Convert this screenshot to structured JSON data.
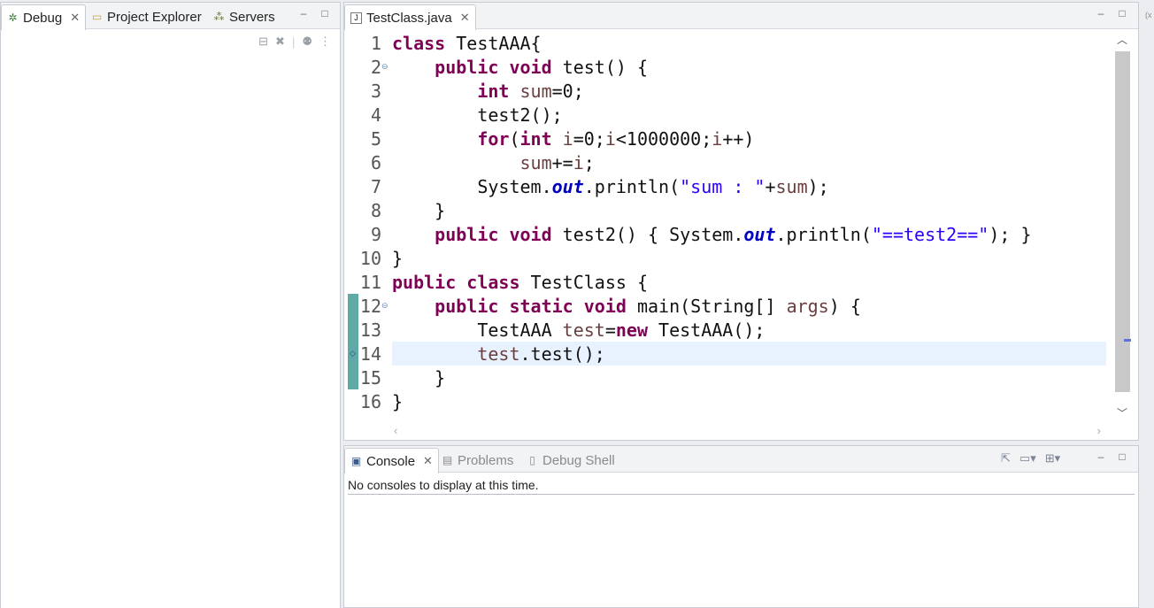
{
  "left_panel": {
    "tabs": [
      {
        "label": "Debug",
        "icon": "bug-icon"
      },
      {
        "label": "Project Explorer",
        "icon": "folder-icon"
      },
      {
        "label": "Servers",
        "icon": "servers-icon"
      }
    ]
  },
  "editor": {
    "tab": {
      "label": "TestClass.java",
      "icon": "java-file-icon"
    },
    "lines": [
      {
        "n": "1"
      },
      {
        "n": "2"
      },
      {
        "n": "3"
      },
      {
        "n": "4"
      },
      {
        "n": "5"
      },
      {
        "n": "6"
      },
      {
        "n": "7"
      },
      {
        "n": "8"
      },
      {
        "n": "9"
      },
      {
        "n": "10"
      },
      {
        "n": "11"
      },
      {
        "n": "12"
      },
      {
        "n": "13"
      },
      {
        "n": "14"
      },
      {
        "n": "15"
      },
      {
        "n": "16"
      }
    ],
    "code": {
      "l1": "class TestAAA{",
      "l2": "    public void test() {",
      "l3": "        int sum=0;",
      "l4": "        test2();",
      "l5": "        for(int i=0;i<1000000;i++)",
      "l6": "            sum+=i;",
      "l7": "        System.out.println(\"sum : \"+sum);",
      "l8": "    }",
      "l9": "    public void test2() { System.out.println(\"==test2==\"); }",
      "l10": "}",
      "l11": "public class TestClass {",
      "l12": "    public static void main(String[] args) {",
      "l13": "        TestAAA test=new TestAAA();",
      "l14": "        test.test();",
      "l15": "    }",
      "l16": "}"
    },
    "current_line": "14"
  },
  "console_panel": {
    "tabs": [
      {
        "label": "Console",
        "icon": "console-icon"
      },
      {
        "label": "Problems",
        "icon": "problems-icon"
      },
      {
        "label": "Debug Shell",
        "icon": "debug-shell-icon"
      }
    ],
    "message": "No consoles to display at this time."
  },
  "right_strip_text": "(x"
}
